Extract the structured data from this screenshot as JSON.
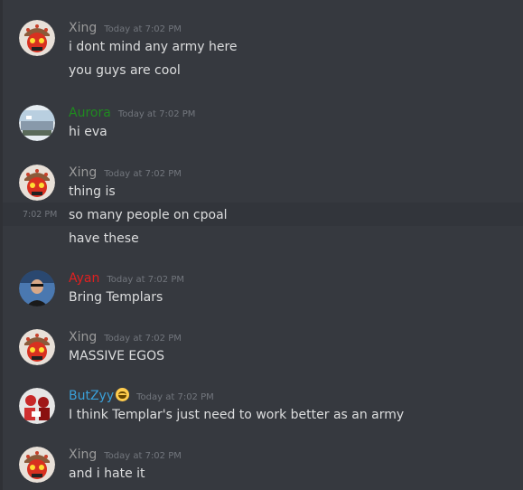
{
  "colors": {
    "background": "#36393f",
    "text": "#dcddde",
    "timestamp": "#72767d",
    "xing": "#9a9a9a",
    "aurora": "#1f8b1f",
    "ayan": "#e02020",
    "butzyy": "#3aa0d8"
  },
  "messages": [
    {
      "author": "Xing",
      "avatar_icon": "crowned-skull-avatar-icon",
      "timestamp": "Today at 7:02 PM",
      "lines": [
        "i dont mind any army here",
        "you guys are cool"
      ]
    },
    {
      "author": "Aurora",
      "avatar_icon": "landscape-photo-avatar-icon",
      "timestamp": "Today at 7:02 PM",
      "lines": [
        "hi eva"
      ]
    },
    {
      "author": "Xing",
      "avatar_icon": "crowned-skull-avatar-icon",
      "timestamp": "Today at 7:02 PM",
      "lines": [
        "thing is",
        "so many people on cpoal",
        "have these"
      ],
      "hover_time": "7:02 PM"
    },
    {
      "author": "Ayan",
      "avatar_icon": "person-photo-avatar-icon",
      "timestamp": "Today at 7:02 PM",
      "lines": [
        "Bring Templars"
      ]
    },
    {
      "author": "Xing",
      "avatar_icon": "crowned-skull-avatar-icon",
      "timestamp": "Today at 7:02 PM",
      "lines": [
        "MASSIVE EGOS"
      ]
    },
    {
      "author": "ButZyy",
      "author_emoji": "grinning-sweat-emoji-icon",
      "avatar_icon": "red-figures-avatar-icon",
      "timestamp": "Today at 7:02 PM",
      "lines": [
        "I think Templar's just need to work better as an army"
      ]
    },
    {
      "author": "Xing",
      "avatar_icon": "crowned-skull-avatar-icon",
      "timestamp": "Today at 7:02 PM",
      "lines": [
        "and i hate it"
      ]
    }
  ]
}
